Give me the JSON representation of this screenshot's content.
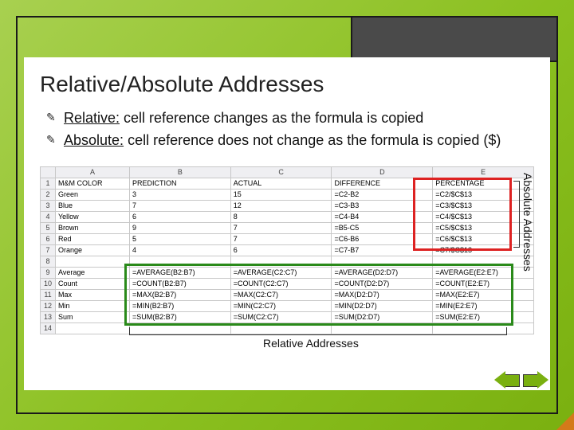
{
  "title": "Relative/Absolute Addresses",
  "bullets": {
    "b1_term": "Relative:",
    "b1_rest": "  cell reference changes as the formula is copied",
    "b2_term": "Absolute:",
    "b2_rest": "  cell reference does not change as the formula is copied ($)"
  },
  "cols": [
    "",
    "A",
    "B",
    "C",
    "D",
    "E"
  ],
  "rows": [
    {
      "n": "1",
      "a": "M&M COLOR",
      "b": "PREDICTION",
      "c": "ACTUAL",
      "d": "DIFFERENCE",
      "e": "PERCENTAGE"
    },
    {
      "n": "2",
      "a": "Green",
      "b": "3",
      "c": "15",
      "d": "=C2-B2",
      "e": "=C2/$C$13"
    },
    {
      "n": "3",
      "a": "Blue",
      "b": "7",
      "c": "12",
      "d": "=C3-B3",
      "e": "=C3/$C$13"
    },
    {
      "n": "4",
      "a": "Yellow",
      "b": "6",
      "c": "8",
      "d": "=C4-B4",
      "e": "=C4/$C$13"
    },
    {
      "n": "5",
      "a": "Brown",
      "b": "9",
      "c": "7",
      "d": "=B5-C5",
      "e": "=C5/$C$13"
    },
    {
      "n": "6",
      "a": "Red",
      "b": "5",
      "c": "7",
      "d": "=C6-B6",
      "e": "=C6/$C$13"
    },
    {
      "n": "7",
      "a": "Orange",
      "b": "4",
      "c": "6",
      "d": "=C7-B7",
      "e": "=C7/$C$13"
    },
    {
      "n": "8",
      "a": "",
      "b": "",
      "c": "",
      "d": "",
      "e": ""
    },
    {
      "n": "9",
      "a": "Average",
      "b": "=AVERAGE(B2:B7)",
      "c": "=AVERAGE(C2:C7)",
      "d": "=AVERAGE(D2:D7)",
      "e": "=AVERAGE(E2:E7)"
    },
    {
      "n": "10",
      "a": "Count",
      "b": "=COUNT(B2:B7)",
      "c": "=COUNT(C2:C7)",
      "d": "=COUNT(D2:D7)",
      "e": "=COUNT(E2:E7)"
    },
    {
      "n": "11",
      "a": "Max",
      "b": "=MAX(B2:B7)",
      "c": "=MAX(C2:C7)",
      "d": "=MAX(D2:D7)",
      "e": "=MAX(E2:E7)"
    },
    {
      "n": "12",
      "a": "Min",
      "b": "=MIN(B2:B7)",
      "c": "=MIN(C2:C7)",
      "d": "=MIN(D2:D7)",
      "e": "=MIN(E2:E7)"
    },
    {
      "n": "13",
      "a": "Sum",
      "b": "=SUM(B2:B7)",
      "c": "=SUM(C2:C7)",
      "d": "=SUM(D2:D7)",
      "e": "=SUM(E2:E7)"
    },
    {
      "n": "14",
      "a": "",
      "b": "",
      "c": "",
      "d": "",
      "e": ""
    }
  ],
  "captions": {
    "bottom": "Relative Addresses",
    "side": "Absolute Addresses"
  }
}
